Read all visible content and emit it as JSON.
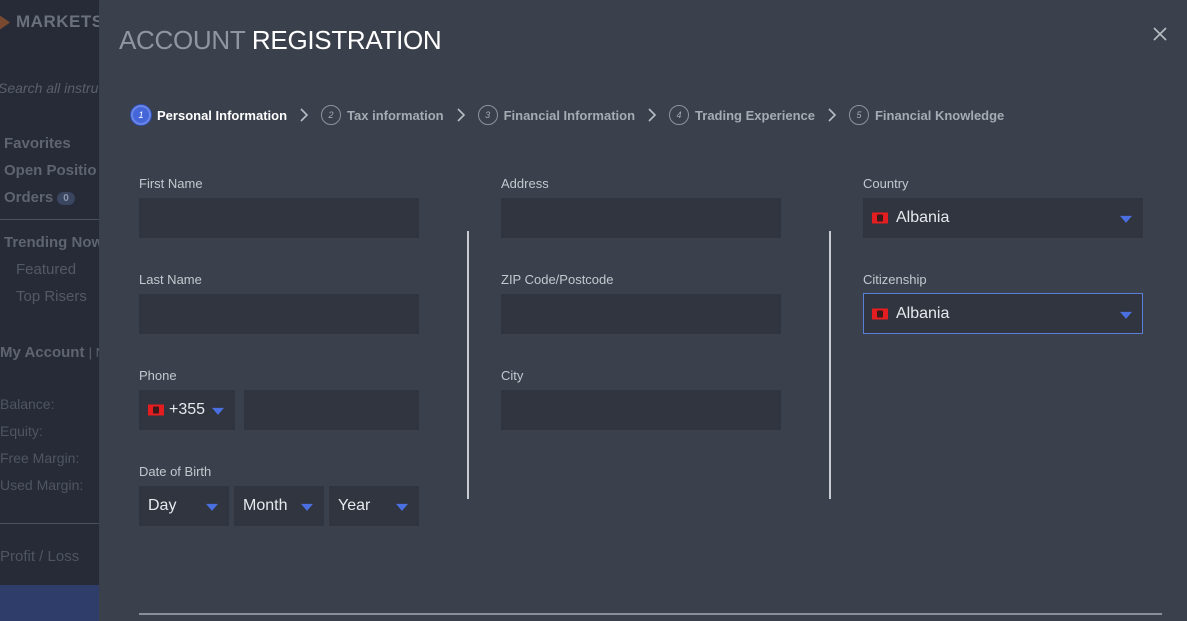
{
  "background": {
    "logo": "MARKETS",
    "search_placeholder": "Search all instru",
    "favorites": "Favorites",
    "open_positions": "Open Positio",
    "orders": "Orders",
    "orders_count": "0",
    "trending_now": "Trending Now",
    "featured": "Featured",
    "top_risers": "Top Risers",
    "my_account": "My Account",
    "my_account_sep": "| N",
    "balance": "Balance:",
    "equity": "Equity:",
    "free_margin": "Free Margin:",
    "used_margin": "Used Margin:",
    "profit_loss": "Profit / Loss"
  },
  "modal": {
    "title_light": "ACCOUNT ",
    "title_bold": "REGISTRATION",
    "steps": [
      {
        "num": "1",
        "label": "Personal Information",
        "active": true
      },
      {
        "num": "2",
        "label": "Tax information",
        "active": false
      },
      {
        "num": "3",
        "label": "Financial Information",
        "active": false
      },
      {
        "num": "4",
        "label": "Trading Experience",
        "active": false
      },
      {
        "num": "5",
        "label": "Financial Knowledge",
        "active": false
      }
    ],
    "form": {
      "first_name_label": "First Name",
      "first_name_value": "",
      "last_name_label": "Last Name",
      "last_name_value": "",
      "phone_label": "Phone",
      "phone_code": "+355",
      "phone_value": "",
      "dob_label": "Date of Birth",
      "dob_day": "Day",
      "dob_month": "Month",
      "dob_year": "Year",
      "address_label": "Address",
      "address_value": "",
      "zip_label": "ZIP Code/Postcode",
      "zip_value": "",
      "city_label": "City",
      "city_value": "",
      "country_label": "Country",
      "country_value": "Albania",
      "citizenship_label": "Citizenship",
      "citizenship_value": "Albania"
    }
  },
  "colors": {
    "modal_bg": "#3b414c",
    "field_bg": "#30353f",
    "accent": "#4566d8",
    "caret": "#4a6fe0"
  }
}
